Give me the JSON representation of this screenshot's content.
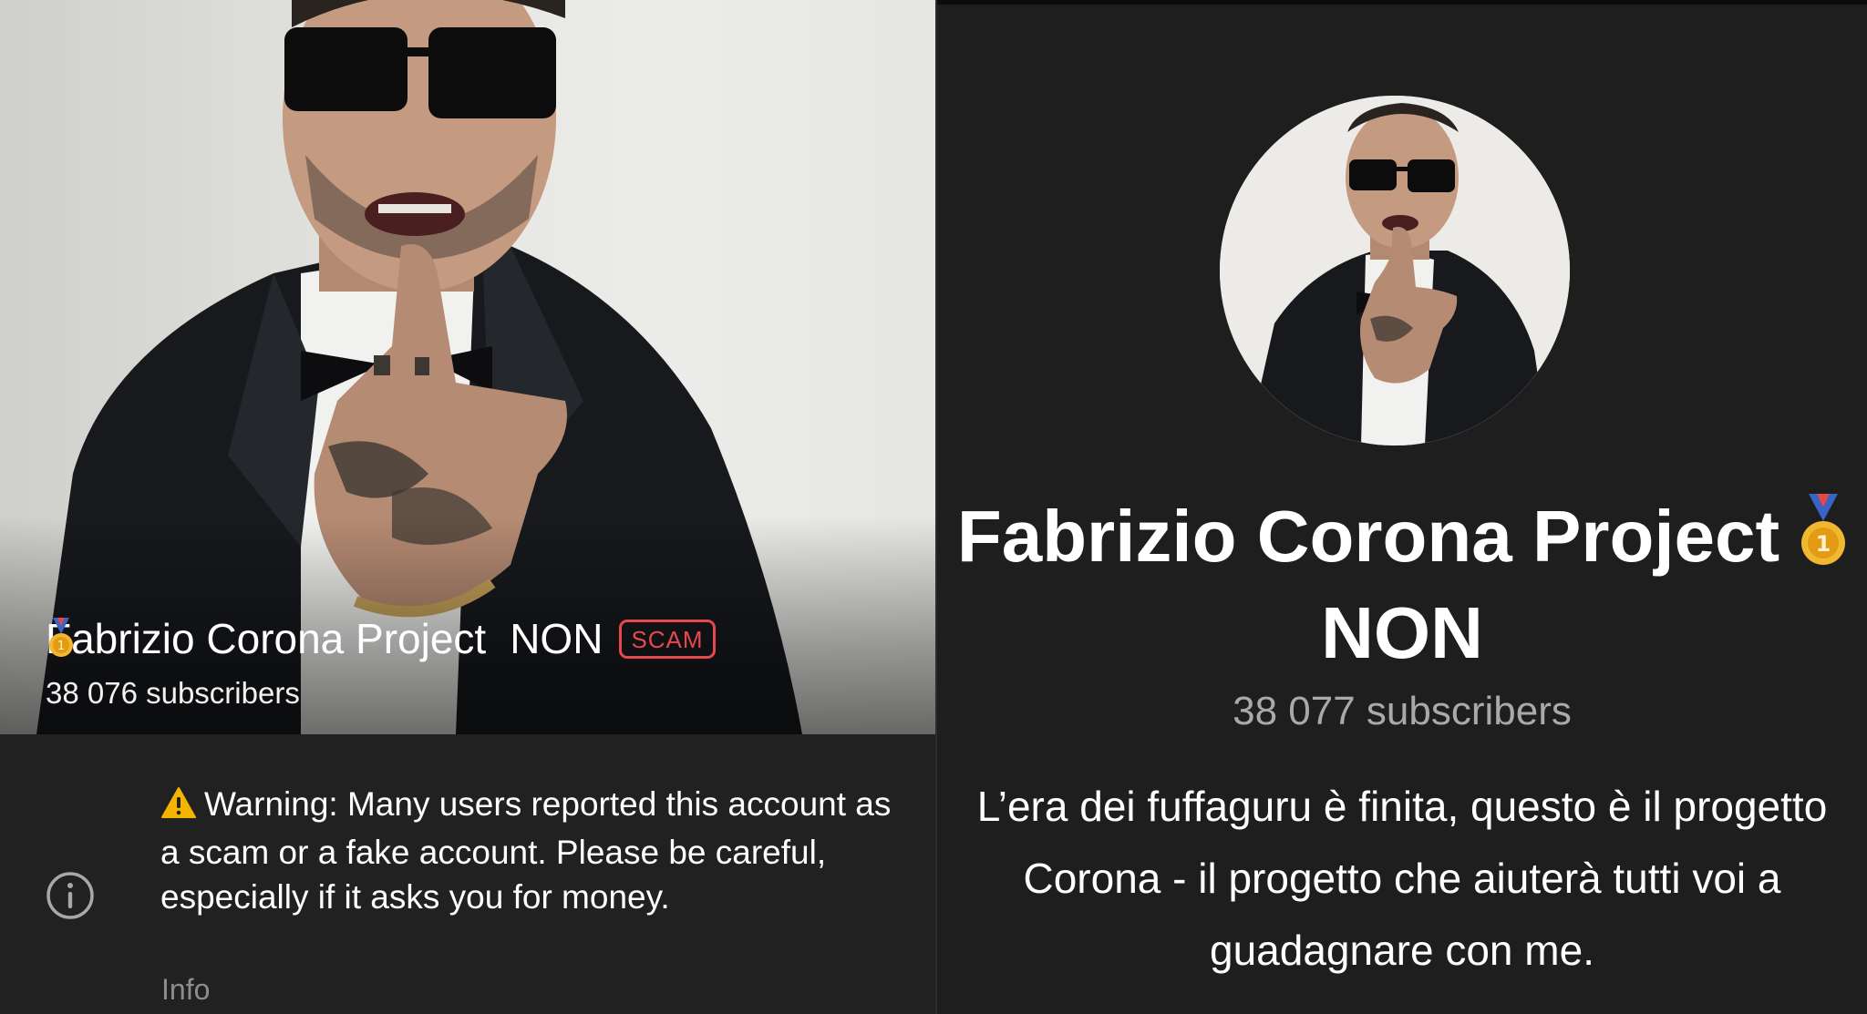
{
  "left": {
    "title": "Fabrizio Corona Project",
    "title_suffix": "NON",
    "badge": "SCAM",
    "subscribers": "38 076 subscribers",
    "warning": "Warning: Many users reported this account as a scam or a fake account. Please be careful, especially if it asks you for money.",
    "info_label": "Info",
    "icons": [
      "medal-icon",
      "warning-icon",
      "info-icon"
    ]
  },
  "right": {
    "title": "Fabrizio Corona Project",
    "title_suffix": "NON",
    "subscribers": "38 077 subscribers",
    "description": "L’era dei fuffaguru è finita, questo è il progetto Corona - il progetto che aiuterà tutti voi a guadagnare con me.",
    "icons": [
      "medal-icon"
    ]
  },
  "colors": {
    "background": "#212121",
    "scam_badge": "#e5484d",
    "muted_text": "#8d8d8d",
    "subtitle_text": "#a9a9a9"
  }
}
